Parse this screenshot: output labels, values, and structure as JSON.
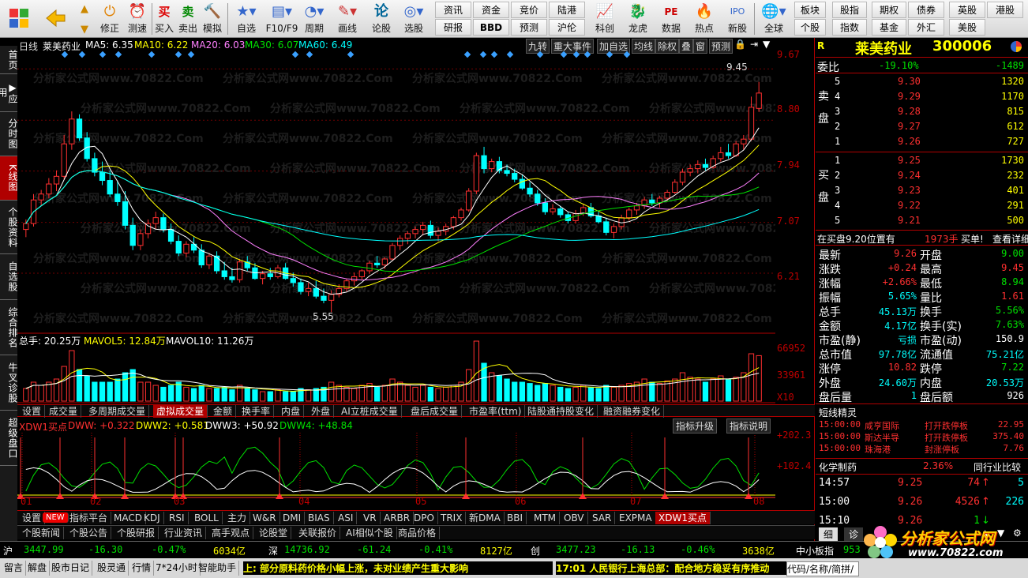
{
  "toolbar": {
    "buttons": [
      "",
      "",
      "修正",
      "测速",
      "买入",
      "卖出",
      "模拟",
      "自选",
      "F10/F9",
      "周期",
      "画线",
      "论股",
      "选股",
      "科创",
      "龙虎",
      "数据",
      "热点",
      "新股",
      "全球"
    ],
    "grid_left": [
      "资讯",
      "资金",
      "竞价",
      "陆港",
      "研报",
      "BBD",
      "预测",
      "沪伦"
    ],
    "grid_right": [
      "板块",
      "股指",
      "期权",
      "债券",
      "英股",
      "港股",
      "个股",
      "指数",
      "基金",
      "外汇",
      "美股"
    ]
  },
  "leftnav": [
    "首页",
    "应用",
    "分时图",
    "K线图",
    "个股资料",
    "自选股",
    "综合排名",
    "牛叉诊股",
    "超级盘口"
  ],
  "chart_header": {
    "period": "日线",
    "stock": "莱美药业",
    "ma5": "MA5: 6.35",
    "ma10": "MA10: 6.22",
    "ma20": "MA20: 6.03",
    "ma30": "MA30: 6.07",
    "ma60": "MA60: 6.49"
  },
  "chart_tools": [
    "九转",
    "重大事件",
    "加自选",
    "均线",
    "除权",
    "叠",
    "窗",
    "预测"
  ],
  "price_axis": [
    "9.67",
    "8.80",
    "7.94",
    "7.07",
    "6.21"
  ],
  "annotations": {
    "high": "9.45",
    "low": "5.55"
  },
  "watermark": "分析家公式网www.70822.Com",
  "vol_header": {
    "total": "总手: 20.25万",
    "mavol5": "MAVOL5: 12.84万",
    "mavol10": "MAVOL10: 11.26万"
  },
  "vol_axis": [
    "66952",
    "33961",
    "X10"
  ],
  "tabs1": [
    "设置",
    "成交量",
    "多周期成交量",
    "虚拟成交量",
    "金额",
    "换手率",
    "内盘",
    "外盘",
    "AI立桩成交量",
    "盘后成交量",
    "市盈率(ttm)",
    "陆股通持股变化",
    "融资融券变化"
  ],
  "ind_header": {
    "name": "XDW1买点",
    "dww": "DWW: +0.322",
    "dww2": "DWW2: +0.581",
    "dww3": "DWW3: +50.92",
    "dww4": "DWW4: +48.84"
  },
  "ind_buttons": [
    "指标升级",
    "指标说明"
  ],
  "ind_axis": [
    "+202.3",
    "+102.4"
  ],
  "months": [
    "01",
    "02",
    "03",
    "04",
    "05",
    "06",
    "07",
    "08"
  ],
  "tabs2": [
    "设置",
    "NEW",
    "指标平台",
    "MACD",
    "KDJ",
    "RSI",
    "BOLL",
    "主力",
    "W&R",
    "DMI",
    "BIAS",
    "ASI",
    "VR",
    "ARBR",
    "DPO",
    "TRIX",
    "新DMA",
    "BBI",
    "MTM",
    "OBV",
    "SAR",
    "EXPMA",
    "XDW1买点"
  ],
  "tabs3": [
    "个股新闻",
    "个股公告",
    "个股研报",
    "行业资讯",
    "高手观点",
    "论股堂",
    "关联报价",
    "AI相似个股",
    "商品价格"
  ],
  "quote": {
    "name": "莱美药业",
    "code": "300006",
    "r": "R",
    "weibi_label": "委比",
    "weibi": "-19.10%",
    "weicha": "-1489",
    "sell_label": "卖盘",
    "buy_label": "买盘",
    "sells": [
      {
        "n": "5",
        "p": "9.30",
        "v": "1320"
      },
      {
        "n": "4",
        "p": "9.29",
        "v": "1170"
      },
      {
        "n": "3",
        "p": "9.28",
        "v": "815"
      },
      {
        "n": "2",
        "p": "9.27",
        "v": "612"
      },
      {
        "n": "1",
        "p": "9.26",
        "v": "727"
      }
    ],
    "buys": [
      {
        "n": "1",
        "p": "9.25",
        "v": "1730"
      },
      {
        "n": "2",
        "p": "9.24",
        "v": "232"
      },
      {
        "n": "3",
        "p": "9.23",
        "v": "401"
      },
      {
        "n": "4",
        "p": "9.22",
        "v": "291"
      },
      {
        "n": "5",
        "p": "9.21",
        "v": "500"
      }
    ],
    "inbuy": "在买盘9.20位置有",
    "inbuy_v": "1973手",
    "inbuy_t": "买单!",
    "detail": "查看详细",
    "stats": [
      [
        "最新",
        "9.26",
        "开盘",
        "9.00"
      ],
      [
        "涨跌",
        "+0.24",
        "最高",
        "9.45"
      ],
      [
        "涨幅",
        "+2.66%",
        "最低",
        "8.94"
      ],
      [
        "振幅",
        "5.65%",
        "量比",
        "1.61"
      ],
      [
        "总手",
        "45.13万",
        "换手",
        "5.56%"
      ],
      [
        "金额",
        "4.17亿",
        "换手(实)",
        "7.63%"
      ],
      [
        "市盈(静)",
        "亏损",
        "市盈(动)",
        "150.9"
      ],
      [
        "总市值",
        "97.78亿",
        "流通值",
        "75.21亿"
      ],
      [
        "涨停",
        "10.82",
        "跌停",
        "7.22"
      ],
      [
        "外盘",
        "24.60万",
        "内盘",
        "20.53万"
      ],
      [
        "盘后量",
        "1",
        "盘后额",
        "926"
      ]
    ],
    "short_title": "短线精灵",
    "shorts": [
      [
        "15:00:00",
        "咸亨国际",
        "打开跌停板",
        "22.95"
      ],
      [
        "15:00:00",
        "斯达半导",
        "打开跌停板",
        "375.40"
      ],
      [
        "15:00:00",
        "珠海港",
        "封涨停板",
        "7.76"
      ]
    ],
    "sector": "化学制药",
    "sector_pct": "2.36%",
    "compare": "同行业比较",
    "ticks": [
      [
        "14:57",
        "9.25",
        "74",
        "5"
      ],
      [
        "15:00",
        "9.26",
        "4526",
        "226"
      ],
      [
        "15:10",
        "9.26",
        "1",
        ""
      ]
    ],
    "tab_detail": "细",
    "tab_diag": "诊"
  },
  "status": {
    "sh_l": "沪",
    "sh": "3447.99",
    "sh_c": "-16.30",
    "sh_p": "-0.47%",
    "sh_a": "6034亿",
    "sz_l": "深",
    "sz": "14736.92",
    "sz_c": "-61.24",
    "sz_p": "-0.41%",
    "sz_a": "8127亿",
    "cy_l": "创",
    "cy": "3477.23",
    "cy_c": "-16.13",
    "cy_p": "-0.46%",
    "cy_a": "3638亿",
    "zx_l": "中小板指",
    "zx": "953"
  },
  "bottom": {
    "items": [
      "留言",
      "解盘",
      "股市日记",
      "股灵通",
      "行情",
      "7*24小时",
      "智能助手"
    ],
    "news1": "上: 部分原料药价格小幅上涨，未对业绩产生重大影响",
    "news2": "17:01 人民银行上海总部：配合地方稳妥有序推动",
    "search": "代码/名称/简拼/"
  },
  "logo": {
    "text": "分析家公式网",
    "url": "www.70822.com"
  },
  "chart_data": {
    "type": "candlestick",
    "title": "莱美药业 300006 日线",
    "ylim": [
      5.3,
      9.9
    ],
    "candles": [
      [
        6.95,
        7.12,
        6.82,
        7.05
      ],
      [
        7.05,
        7.55,
        7.0,
        7.45
      ],
      [
        7.45,
        7.62,
        7.35,
        7.55
      ],
      [
        7.55,
        7.82,
        7.48,
        7.72
      ],
      [
        7.72,
        7.95,
        7.6,
        7.85
      ],
      [
        7.85,
        8.55,
        7.8,
        8.4
      ],
      [
        8.4,
        8.95,
        8.3,
        8.82
      ],
      [
        8.82,
        8.9,
        8.45,
        8.5
      ],
      [
        8.5,
        8.6,
        8.1,
        8.15
      ],
      [
        8.15,
        8.25,
        7.85,
        7.92
      ],
      [
        7.92,
        8.1,
        7.7,
        7.78
      ],
      [
        7.78,
        7.95,
        7.5,
        7.55
      ],
      [
        7.55,
        7.78,
        7.35,
        7.42
      ],
      [
        7.42,
        7.6,
        6.95,
        7.02
      ],
      [
        7.02,
        7.15,
        6.6,
        6.68
      ],
      [
        6.68,
        6.95,
        6.6,
        6.88
      ],
      [
        6.88,
        7.12,
        6.8,
        7.05
      ],
      [
        7.05,
        7.25,
        6.95,
        7.15
      ],
      [
        7.15,
        7.22,
        6.9,
        6.95
      ],
      [
        6.95,
        7.05,
        6.7,
        6.75
      ],
      [
        6.75,
        6.85,
        6.5,
        6.55
      ],
      [
        6.55,
        6.75,
        6.48,
        6.7
      ],
      [
        6.7,
        6.82,
        6.55,
        6.6
      ],
      [
        6.6,
        6.7,
        6.3,
        6.35
      ],
      [
        6.35,
        6.55,
        6.28,
        6.5
      ],
      [
        6.5,
        6.58,
        6.2,
        6.25
      ],
      [
        6.25,
        6.4,
        6.1,
        6.15
      ],
      [
        6.15,
        6.3,
        6.05,
        6.1
      ],
      [
        6.1,
        6.45,
        6.05,
        6.4
      ],
      [
        6.4,
        6.5,
        6.25,
        6.3
      ],
      [
        6.3,
        6.38,
        6.1,
        6.12
      ],
      [
        6.12,
        6.25,
        6.02,
        6.2
      ],
      [
        6.2,
        6.3,
        6.1,
        6.15
      ],
      [
        6.15,
        6.35,
        6.12,
        6.3
      ],
      [
        6.3,
        6.38,
        6.1,
        6.12
      ],
      [
        6.12,
        6.22,
        5.98,
        6.05
      ],
      [
        6.05,
        6.12,
        5.85,
        5.9
      ],
      [
        5.9,
        6.05,
        5.82,
        5.95
      ],
      [
        5.95,
        6.08,
        5.78,
        5.82
      ],
      [
        5.82,
        5.95,
        5.7,
        5.75
      ],
      [
        5.75,
        5.92,
        5.55,
        5.85
      ],
      [
        5.85,
        6.02,
        5.8,
        5.95
      ],
      [
        5.95,
        6.12,
        5.9,
        6.08
      ],
      [
        6.08,
        6.22,
        6.0,
        6.15
      ],
      [
        6.15,
        6.28,
        6.1,
        6.25
      ],
      [
        6.25,
        6.42,
        6.2,
        6.38
      ],
      [
        6.38,
        6.5,
        6.3,
        6.35
      ],
      [
        6.35,
        6.48,
        6.28,
        6.45
      ],
      [
        6.45,
        6.72,
        6.42,
        6.68
      ],
      [
        6.68,
        6.85,
        6.6,
        6.8
      ],
      [
        6.8,
        6.92,
        6.7,
        6.88
      ],
      [
        6.88,
        7.0,
        6.8,
        6.95
      ],
      [
        6.95,
        7.08,
        6.85,
        7.02
      ],
      [
        7.02,
        7.1,
        6.8,
        6.85
      ],
      [
        6.85,
        6.98,
        6.75,
        6.92
      ],
      [
        6.92,
        7.05,
        6.85,
        7.0
      ],
      [
        7.0,
        7.18,
        6.95,
        7.15
      ],
      [
        7.15,
        7.32,
        7.1,
        7.28
      ],
      [
        7.28,
        7.65,
        7.25,
        7.6
      ],
      [
        7.6,
        8.25,
        7.55,
        8.2
      ],
      [
        8.2,
        8.35,
        7.9,
        7.98
      ],
      [
        7.98,
        8.15,
        7.92,
        8.1
      ],
      [
        8.1,
        8.18,
        7.9,
        7.95
      ],
      [
        7.95,
        8.05,
        7.85,
        7.9
      ],
      [
        7.9,
        7.98,
        7.75,
        7.8
      ],
      [
        7.8,
        7.88,
        7.62,
        7.65
      ],
      [
        7.65,
        7.75,
        7.5,
        7.55
      ],
      [
        7.55,
        7.62,
        7.35,
        7.4
      ],
      [
        7.4,
        7.48,
        7.2,
        7.25
      ],
      [
        7.25,
        7.38,
        7.2,
        7.3
      ],
      [
        7.3,
        7.35,
        7.15,
        7.2
      ],
      [
        7.2,
        7.25,
        7.05,
        7.1
      ],
      [
        7.1,
        7.28,
        7.05,
        7.22
      ],
      [
        7.22,
        7.38,
        7.18,
        7.32
      ],
      [
        7.32,
        7.4,
        7.15,
        7.18
      ],
      [
        7.18,
        7.25,
        7.05,
        7.08
      ],
      [
        7.08,
        7.15,
        6.85,
        6.9
      ],
      [
        6.9,
        7.05,
        6.8,
        7.0
      ],
      [
        7.0,
        7.2,
        6.95,
        7.15
      ],
      [
        7.15,
        7.32,
        7.1,
        7.28
      ],
      [
        7.28,
        7.4,
        7.2,
        7.35
      ],
      [
        7.35,
        7.5,
        7.3,
        7.45
      ],
      [
        7.45,
        7.55,
        7.35,
        7.4
      ],
      [
        7.4,
        7.52,
        7.32,
        7.48
      ],
      [
        7.48,
        7.62,
        7.42,
        7.58
      ],
      [
        7.58,
        7.8,
        7.55,
        7.75
      ],
      [
        7.75,
        7.98,
        7.7,
        7.92
      ],
      [
        7.92,
        8.05,
        7.85,
        7.98
      ],
      [
        7.98,
        8.12,
        7.9,
        8.05
      ],
      [
        8.05,
        8.15,
        7.95,
        8.0
      ],
      [
        8.0,
        8.2,
        7.98,
        8.15
      ],
      [
        8.15,
        8.35,
        8.1,
        8.25
      ],
      [
        8.25,
        8.4,
        8.15,
        8.2
      ],
      [
        8.2,
        8.45,
        8.18,
        8.4
      ],
      [
        8.4,
        8.55,
        8.3,
        8.48
      ],
      [
        8.48,
        9.2,
        8.45,
        9.02
      ],
      [
        9.0,
        9.45,
        8.94,
        9.26
      ]
    ],
    "ma5": [
      6.35
    ],
    "ma10": [
      6.22
    ],
    "ma20": [
      6.03
    ],
    "ma30": [
      6.07
    ],
    "ma60": [
      6.49
    ],
    "volumes_rel": [
      0.2,
      0.3,
      0.25,
      0.3,
      0.35,
      0.55,
      0.8,
      0.5,
      0.4,
      0.3,
      0.3,
      0.3,
      0.35,
      0.45,
      0.5,
      0.3,
      0.3,
      0.25,
      0.22,
      0.25,
      0.3,
      0.22,
      0.2,
      0.25,
      0.2,
      0.2,
      0.22,
      0.18,
      0.25,
      0.2,
      0.18,
      0.15,
      0.15,
      0.18,
      0.15,
      0.15,
      0.2,
      0.18,
      0.2,
      0.22,
      0.3,
      0.25,
      0.22,
      0.2,
      0.25,
      0.28,
      0.22,
      0.25,
      0.35,
      0.3,
      0.25,
      0.22,
      0.25,
      0.22,
      0.2,
      0.22,
      0.25,
      0.3,
      0.5,
      0.95,
      0.6,
      0.45,
      0.4,
      0.35,
      0.3,
      0.3,
      0.28,
      0.25,
      0.28,
      0.25,
      0.22,
      0.2,
      0.22,
      0.25,
      0.22,
      0.2,
      0.25,
      0.22,
      0.25,
      0.28,
      0.3,
      0.35,
      0.3,
      0.28,
      0.32,
      0.35,
      0.45,
      0.38,
      0.35,
      0.3,
      0.35,
      0.4,
      0.35,
      0.38,
      0.45,
      0.75,
      0.72
    ]
  }
}
